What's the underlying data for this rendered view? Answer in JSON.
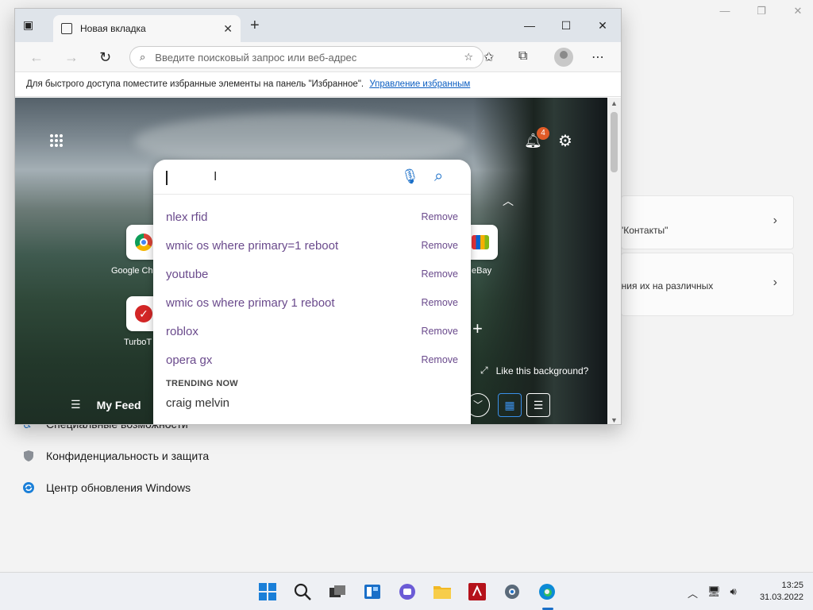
{
  "settings": {
    "card1_text": "\"Контакты\"",
    "card2_text": "ления их на различных",
    "nav_items": [
      {
        "label": "Специальные возможности"
      },
      {
        "label": "Конфиденциальность и защита"
      },
      {
        "label": "Центр обновления Windows"
      }
    ]
  },
  "browser": {
    "tab_title": "Новая вкладка",
    "address_placeholder": "Введите поисковый запрос или веб-адрес",
    "favbar_text": "Для быстрого доступа поместите избранные элементы на панель \"Избранное\".",
    "favbar_link": "Управление избранным"
  },
  "ntp": {
    "notification_count": "4",
    "tiles": [
      {
        "label": "Google Ch",
        "icon": "chrome-icon"
      },
      {
        "label": "TurboT",
        "icon": "turbotax-icon"
      },
      {
        "label": "eBay",
        "icon": "ebay-icon"
      }
    ],
    "like_background": "Like this background?",
    "my_feed": "My Feed"
  },
  "search": {
    "suggestions": [
      {
        "query": "nlex rfid",
        "action": "Remove"
      },
      {
        "query": "wmic os where primary=1 reboot",
        "action": "Remove"
      },
      {
        "query": "youtube",
        "action": "Remove"
      },
      {
        "query": "wmic os where primary 1 reboot",
        "action": "Remove"
      },
      {
        "query": "roblox",
        "action": "Remove"
      },
      {
        "query": "opera gx",
        "action": "Remove"
      }
    ],
    "trending_header": "TRENDING NOW",
    "trending": [
      "craig melvin"
    ]
  },
  "taskbar": {
    "time": "13:25",
    "date": "31.03.2022",
    "apps": [
      "start-icon",
      "search-icon",
      "task-view-icon",
      "widgets-icon",
      "chat-icon",
      "file-explorer-icon",
      "foxit-icon",
      "settings-icon",
      "edge-icon"
    ]
  },
  "colors": {
    "accent": "#1a6fc8",
    "suggestion_text": "#6a4a8c",
    "badge": "#e05b27"
  }
}
